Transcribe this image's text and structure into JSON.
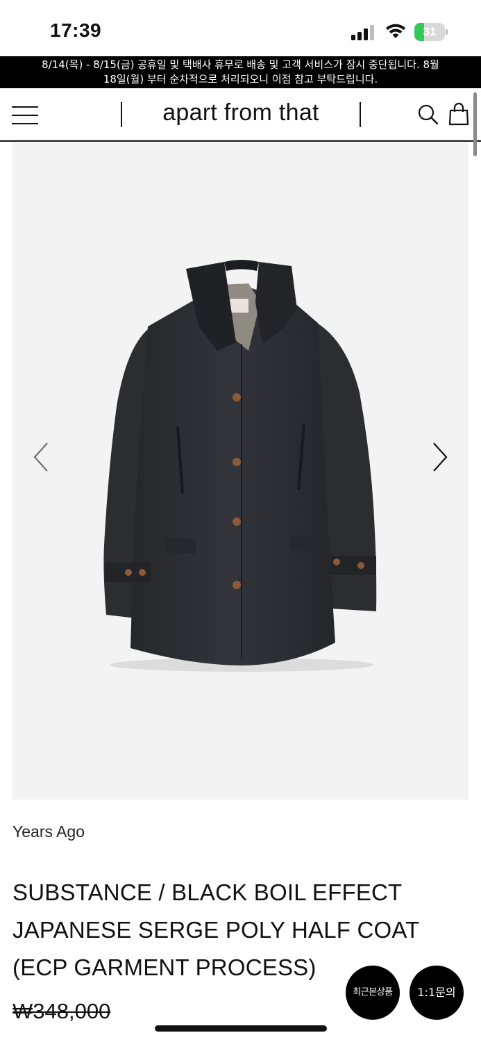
{
  "status_bar": {
    "time": "17:39",
    "battery_level": "31",
    "battery_fraction": 0.31,
    "icons": [
      "cellular-signal-icon",
      "wifi-icon",
      "battery-icon"
    ]
  },
  "notice": {
    "line1": "8/14(목) - 8/15(금) 공휴일 및 택배사 휴무로 배송 및 고객 서비스가 잠시 중단됩니다. 8월",
    "line2": "18일(월) 부터 순차적으로 처리되오니 이점 참고 부탁드립니다."
  },
  "header": {
    "brand": "apart from that",
    "icons": [
      "menu-icon",
      "search-icon",
      "shopping-bag-icon"
    ]
  },
  "gallery": {
    "icons": [
      "chevron-left-icon",
      "chevron-right-icon"
    ],
    "label_on_garment": "years ago"
  },
  "product": {
    "brand": "Years Ago",
    "title_lines": [
      "SUBSTANCE / BLACK BOIL EFFECT",
      "JAPANESE SERGE POLY HALF COAT",
      "(ECP GARMENT PROCESS)"
    ],
    "price": "₩348,000"
  },
  "floating_buttons": {
    "recent": "최근본상품",
    "inquiry": "1:1문의"
  },
  "colors": {
    "banner_bg": "#000000",
    "image_bg": "#f3f3f3",
    "battery_green": "#34c759"
  }
}
